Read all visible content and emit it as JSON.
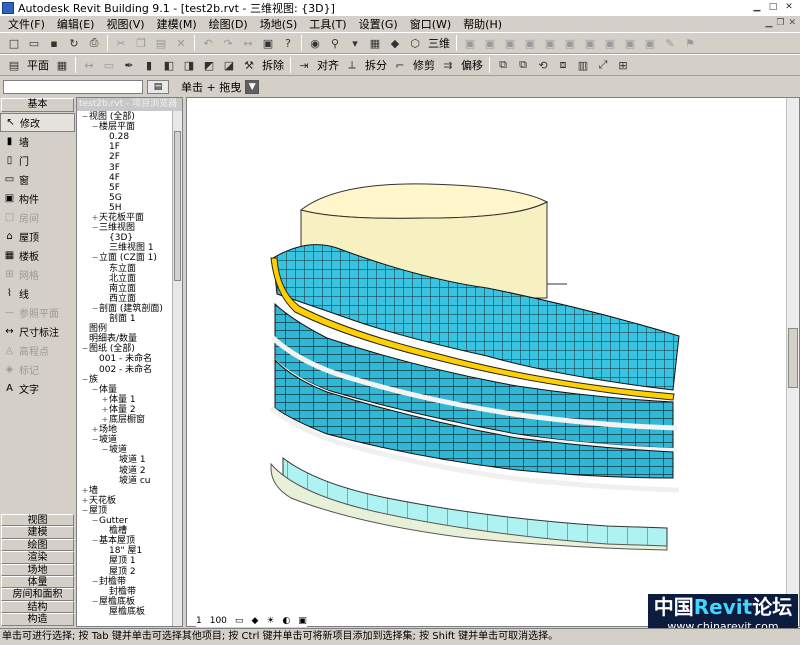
{
  "window": {
    "title": "Autodesk Revit Building 9.1 - [test2b.rvt - 三维视图: {3D}]"
  },
  "menu": [
    "文件(F)",
    "编辑(E)",
    "视图(V)",
    "建模(M)",
    "绘图(D)",
    "场地(S)",
    "工具(T)",
    "设置(G)",
    "窗口(W)",
    "帮助(H)"
  ],
  "toolbar": {
    "view3d_label": "三维"
  },
  "toolbar2": {
    "plan": "平面",
    "demolish": "拆除",
    "align": "对齐",
    "split": "拆分",
    "trim": "修剪",
    "offset": "偏移"
  },
  "options": {
    "click_drag": "单击 + 拖曳"
  },
  "design_bar": {
    "tab": "基本",
    "items": [
      {
        "label": "修改",
        "state": "sel"
      },
      {
        "label": "墙",
        "state": ""
      },
      {
        "label": "门",
        "state": ""
      },
      {
        "label": "窗",
        "state": ""
      },
      {
        "label": "构件",
        "state": ""
      },
      {
        "label": "房间",
        "state": "dis"
      },
      {
        "label": "屋顶",
        "state": ""
      },
      {
        "label": "楼板",
        "state": ""
      },
      {
        "label": "网格",
        "state": "dis"
      },
      {
        "label": "线",
        "state": ""
      },
      {
        "label": "参照平面",
        "state": "dis"
      },
      {
        "label": "尺寸标注",
        "state": ""
      },
      {
        "label": "高程点",
        "state": "dis"
      },
      {
        "label": "标记",
        "state": "dis"
      },
      {
        "label": "文字",
        "state": ""
      }
    ],
    "tabs": [
      "视图",
      "建模",
      "绘图",
      "渲染",
      "场地",
      "体量",
      "房间和面积",
      "结构",
      "构造"
    ]
  },
  "browser": {
    "header": "test2b.rvt - 项目浏览器",
    "nodes": [
      {
        "ex": "−",
        "t": "视图 (全部)",
        "lv": 0
      },
      {
        "ex": "−",
        "t": "楼层平面",
        "lv": 1
      },
      {
        "ex": "",
        "t": "0.28",
        "lv": 2
      },
      {
        "ex": "",
        "t": "1F",
        "lv": 2
      },
      {
        "ex": "",
        "t": "2F",
        "lv": 2
      },
      {
        "ex": "",
        "t": "3F",
        "lv": 2
      },
      {
        "ex": "",
        "t": "4F",
        "lv": 2
      },
      {
        "ex": "",
        "t": "5F",
        "lv": 2
      },
      {
        "ex": "",
        "t": "5G",
        "lv": 2
      },
      {
        "ex": "",
        "t": "5H",
        "lv": 2
      },
      {
        "ex": "+",
        "t": "天花板平面",
        "lv": 1
      },
      {
        "ex": "−",
        "t": "三维视图",
        "lv": 1
      },
      {
        "ex": "",
        "t": "{3D}",
        "lv": 2
      },
      {
        "ex": "",
        "t": "三维视图 1",
        "lv": 2
      },
      {
        "ex": "−",
        "t": "立面 (CZ面 1)",
        "lv": 1
      },
      {
        "ex": "",
        "t": "东立面",
        "lv": 2
      },
      {
        "ex": "",
        "t": "北立面",
        "lv": 2
      },
      {
        "ex": "",
        "t": "南立面",
        "lv": 2
      },
      {
        "ex": "",
        "t": "西立面",
        "lv": 2
      },
      {
        "ex": "−",
        "t": "剖面 (建筑剖面)",
        "lv": 1
      },
      {
        "ex": "",
        "t": "剖面 1",
        "lv": 2
      },
      {
        "ex": "",
        "t": "图例",
        "lv": 0
      },
      {
        "ex": "",
        "t": "明细表/数量",
        "lv": 0
      },
      {
        "ex": "−",
        "t": "图纸 (全部)",
        "lv": 0
      },
      {
        "ex": "",
        "t": "001 - 未命名",
        "lv": 1
      },
      {
        "ex": "",
        "t": "002 - 未命名",
        "lv": 1
      },
      {
        "ex": "−",
        "t": "族",
        "lv": 0
      },
      {
        "ex": "−",
        "t": "体量",
        "lv": 1
      },
      {
        "ex": "+",
        "t": "体量 1",
        "lv": 2
      },
      {
        "ex": "+",
        "t": "体量 2",
        "lv": 2
      },
      {
        "ex": "+",
        "t": "底层橱窗",
        "lv": 2
      },
      {
        "ex": "+",
        "t": "场地",
        "lv": 1
      },
      {
        "ex": "−",
        "t": "坡道",
        "lv": 1
      },
      {
        "ex": "−",
        "t": "坡道",
        "lv": 2
      },
      {
        "ex": "",
        "t": "坡道 1",
        "lv": 3
      },
      {
        "ex": "",
        "t": "坡道 2",
        "lv": 3
      },
      {
        "ex": "",
        "t": "坡道 cu",
        "lv": 3
      },
      {
        "ex": "+",
        "t": "墙",
        "lv": 0
      },
      {
        "ex": "+",
        "t": "天花板",
        "lv": 0
      },
      {
        "ex": "−",
        "t": "屋顶",
        "lv": 0
      },
      {
        "ex": "−",
        "t": "Gutter",
        "lv": 1
      },
      {
        "ex": "",
        "t": "檐槽",
        "lv": 2
      },
      {
        "ex": "−",
        "t": "基本屋顶",
        "lv": 1
      },
      {
        "ex": "",
        "t": "18\" 屋1",
        "lv": 2
      },
      {
        "ex": "",
        "t": "屋顶 1",
        "lv": 2
      },
      {
        "ex": "",
        "t": "屋顶 2",
        "lv": 2
      },
      {
        "ex": "−",
        "t": "封檐带",
        "lv": 1
      },
      {
        "ex": "",
        "t": "封檐带",
        "lv": 2
      },
      {
        "ex": "−",
        "t": "屋檐底板",
        "lv": 1
      },
      {
        "ex": "",
        "t": "屋檐底板",
        "lv": 2
      }
    ]
  },
  "view_control": {
    "scale_prefix": "1",
    "scale_value": "100"
  },
  "status": "单击可进行选择; 按 Tab 键并单击可选择其他项目; 按 Ctrl 键并单击可将新项目添加到选择集; 按 Shift 键并单击可取消选择。",
  "watermark": {
    "line1_a": "中国",
    "line1_b": "Revit",
    "line1_c": "论坛",
    "line2": "www.chinarevit.com"
  },
  "colors": {
    "glass": "#38c3e0",
    "frame": "#1a2a30",
    "roof_edge": "#ffd000",
    "tower": "#f7f0c0"
  }
}
